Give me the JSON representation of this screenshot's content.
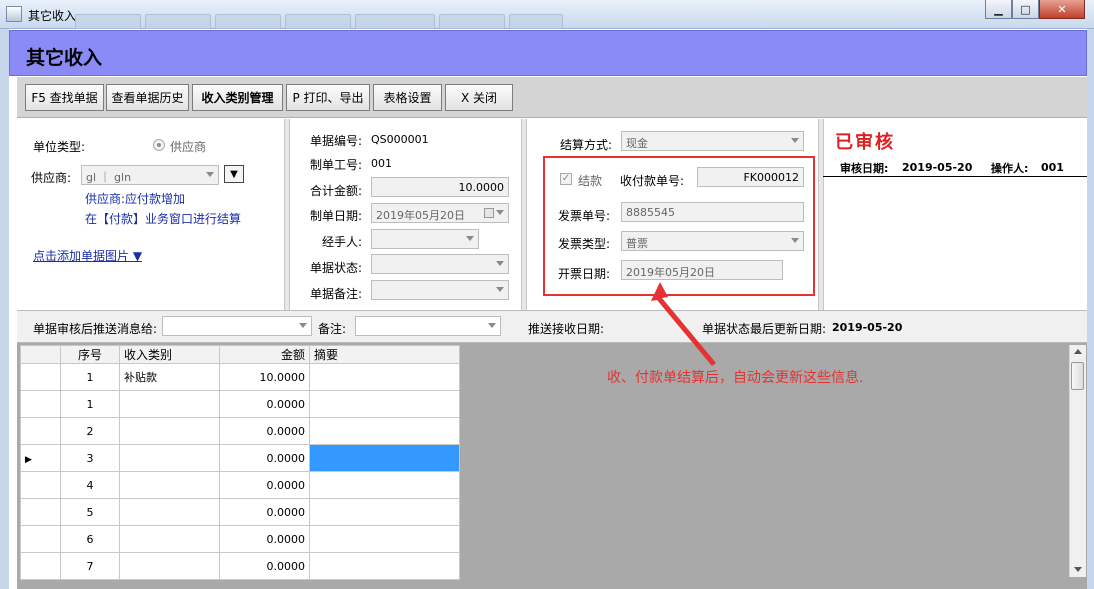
{
  "window": {
    "title": "其它收入",
    "minimize_symbol": "▁",
    "maximize_symbol": "□",
    "close_symbol": "✕"
  },
  "header": {
    "title": "其它收入",
    "band_color": "#8b8bf7"
  },
  "toolbar": {
    "buttons": [
      {
        "label": "F5 查找单据"
      },
      {
        "label": "查看单据历史"
      },
      {
        "label": "收入类别管理"
      },
      {
        "label": "P 打印、导出"
      },
      {
        "label": "表格设置"
      },
      {
        "label": "X 关闭"
      }
    ]
  },
  "left_panel": {
    "unit_type_label": "单位类型:",
    "unit_type_option": "供应商",
    "supplier_label": "供应商:",
    "supplier_value": "gl ｜ gln",
    "note_line1": "供应商:应付款增加",
    "note_line2": "在【付款】业务窗口进行结算",
    "add_image_link": "点击添加单据图片 ▼"
  },
  "doc_panel": {
    "doc_no_label": "单据编号:",
    "doc_no_value": "QS000001",
    "maker_label": "制单工号:",
    "maker_value": "001",
    "total_label": "合计金额:",
    "total_value": "10.0000",
    "date_label": "制单日期:",
    "date_value": "2019年05月20日",
    "handler_label": "经手人:",
    "status_label": "单据状态:",
    "remark_label": "单据备注:"
  },
  "settle_panel": {
    "method_label": "结算方式:",
    "method_value": "现金",
    "settled_checkbox_label": "结款",
    "payment_no_label": "收付款单号:",
    "payment_no_value": "FK000012",
    "invoice_no_label": "发票单号:",
    "invoice_no_value": "8885545",
    "invoice_type_label": "发票类型:",
    "invoice_type_value": "普票",
    "invoice_date_label": "开票日期:",
    "invoice_date_value": "2019年05月20日"
  },
  "audit_panel": {
    "stamp": "已审核",
    "audit_date_label": "审核日期:",
    "audit_date_value": "2019-05-20",
    "operator_label": "操作人:",
    "operator_value": "001"
  },
  "annotation": {
    "text": "收、付款单结算后，自动会更新这些信息.",
    "color": "#e53232"
  },
  "info_row": {
    "push_label": "单据审核后推送消息给:",
    "remark_label": "备注:",
    "push_date_label": "推送接收日期:",
    "last_update_label": "单据状态最后更新日期:",
    "last_update_value": "2019-05-20"
  },
  "grid": {
    "columns": [
      "序号",
      "收入类别",
      "金额",
      "摘要"
    ],
    "rows": [
      {
        "seq": "1",
        "category": "补贴款",
        "amount": "10.0000",
        "memo": ""
      },
      {
        "seq": "1",
        "category": "",
        "amount": "0.0000",
        "memo": ""
      },
      {
        "seq": "2",
        "category": "",
        "amount": "0.0000",
        "memo": ""
      },
      {
        "seq": "3",
        "category": "",
        "amount": "0.0000",
        "memo": "",
        "current": true
      },
      {
        "seq": "4",
        "category": "",
        "amount": "0.0000",
        "memo": ""
      },
      {
        "seq": "5",
        "category": "",
        "amount": "0.0000",
        "memo": ""
      },
      {
        "seq": "6",
        "category": "",
        "amount": "0.0000",
        "memo": ""
      },
      {
        "seq": "7",
        "category": "",
        "amount": "0.0000",
        "memo": ""
      }
    ]
  }
}
